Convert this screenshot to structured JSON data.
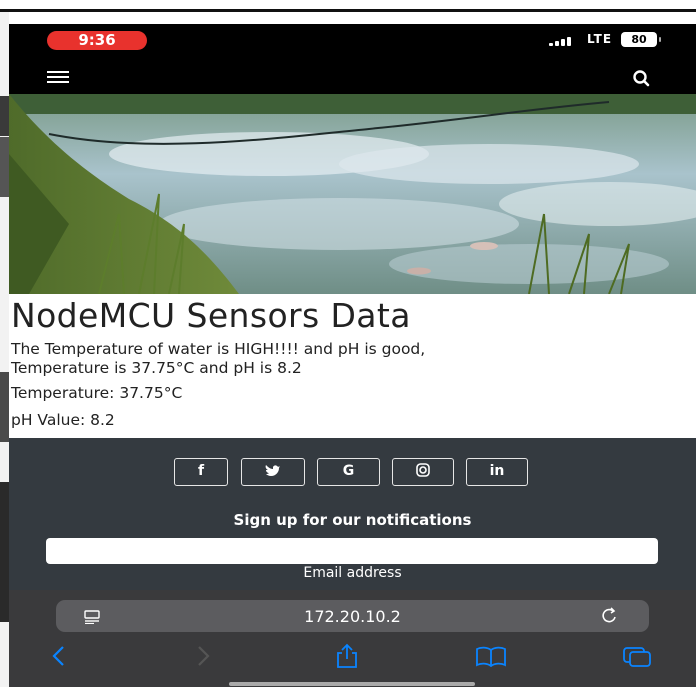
{
  "status_bar": {
    "time": "9:36",
    "network": "LTE",
    "battery": "80"
  },
  "navbar": {
    "menu_icon": "hamburger-icon",
    "search_icon": "search-icon"
  },
  "hero": {
    "image": "pond-water-photo"
  },
  "page": {
    "title": "NodeMCU Sensors Data",
    "message_line1": "The Temperature of water is HIGH!!!! and pH is good,",
    "message_line2": "Temperature is 37.75°C and pH is 8.2",
    "temperature": "Temperature: 37.75°C",
    "ph_value": "pH Value: 8.2"
  },
  "footer": {
    "social": [
      {
        "label": "f",
        "icon": "facebook-icon"
      },
      {
        "label": "twitter",
        "icon": "twitter-icon"
      },
      {
        "label": "G",
        "icon": "google-icon"
      },
      {
        "label": "instagram",
        "icon": "instagram-icon"
      },
      {
        "label": "in",
        "icon": "linkedin-icon"
      }
    ],
    "signup_heading": "Sign up for our notifications",
    "email_label": "Email address",
    "email_value": ""
  },
  "browser": {
    "url": "172.20.10.2",
    "accent": "#0a84ff",
    "icons": [
      "back-icon",
      "forward-icon",
      "share-icon",
      "bookmarks-icon",
      "tabs-icon"
    ]
  },
  "colors": {
    "footer_bg": "#343a40",
    "time_pill": "#e8322d",
    "safari_bar": "#3a3a3c"
  }
}
